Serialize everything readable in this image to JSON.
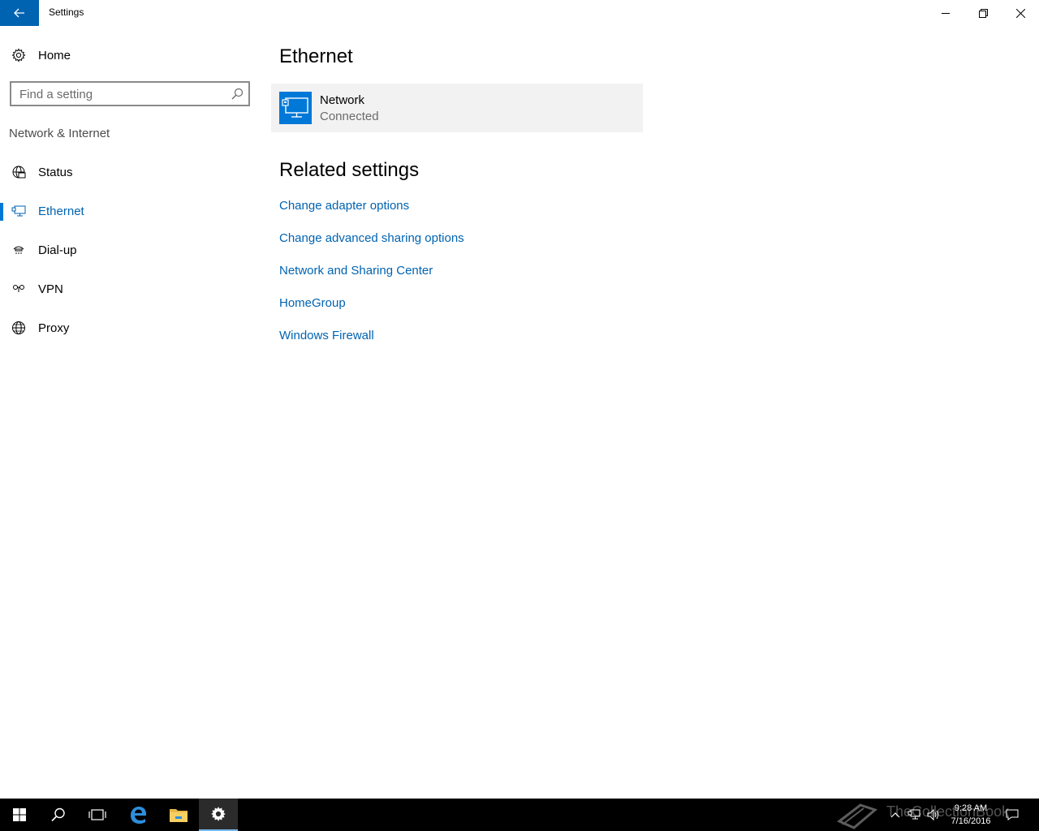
{
  "window": {
    "title": "Settings"
  },
  "sidebar": {
    "home_label": "Home",
    "search_placeholder": "Find a setting",
    "section_label": "Network & Internet",
    "items": [
      {
        "label": "Status",
        "icon": "globe-status-icon",
        "active": false
      },
      {
        "label": "Ethernet",
        "icon": "ethernet-icon",
        "active": true
      },
      {
        "label": "Dial-up",
        "icon": "dial-up-icon",
        "active": false
      },
      {
        "label": "VPN",
        "icon": "vpn-icon",
        "active": false
      },
      {
        "label": "Proxy",
        "icon": "globe-icon",
        "active": false
      }
    ]
  },
  "main": {
    "title": "Ethernet",
    "network": {
      "name": "Network",
      "status": "Connected"
    },
    "related_title": "Related settings",
    "related_links": [
      "Change adapter options",
      "Change advanced sharing options",
      "Network and Sharing Center",
      "HomeGroup",
      "Windows Firewall"
    ]
  },
  "taskbar": {
    "time": "9:28 AM",
    "date": "7/16/2016",
    "watermark": "TheCollectionBook"
  },
  "colors": {
    "accent": "#0078d7",
    "link": "#0063b1",
    "card_bg": "#f2f2f2",
    "taskbar": "#000000"
  }
}
